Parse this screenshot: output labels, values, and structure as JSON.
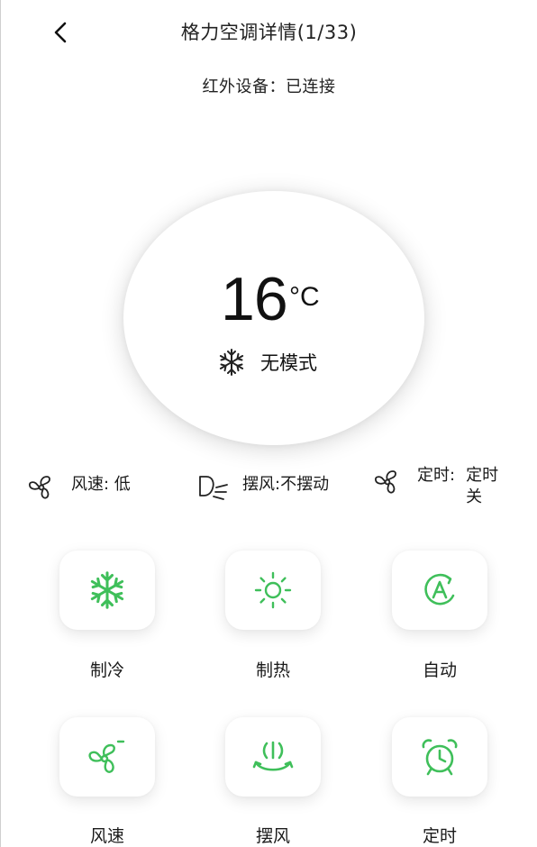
{
  "header": {
    "title": "格力空调详情(1/33)",
    "back_icon": "chevron-left-icon"
  },
  "status": {
    "label": "红外设备：",
    "value": "已连接"
  },
  "temperature": {
    "value": "16",
    "unit": "°C",
    "mode_icon": "snowflake-icon",
    "mode": "无模式"
  },
  "info": {
    "fan_speed": {
      "icon": "fan-icon",
      "text": "风速: 低"
    },
    "swing": {
      "icon": "swing-icon",
      "text": "摆风:不摆动"
    },
    "timer": {
      "icon": "fan-icon",
      "line1": "定时:",
      "line2": "定时关"
    }
  },
  "buttons": [
    {
      "label": "制冷",
      "icon": "snowflake-icon"
    },
    {
      "label": "制热",
      "icon": "sun-icon"
    },
    {
      "label": "自动",
      "icon": "auto-mode-icon"
    },
    {
      "label": "风速",
      "icon": "fan-speed-icon"
    },
    {
      "label": "摆风",
      "icon": "swing-wind-icon"
    },
    {
      "label": "定时",
      "icon": "alarm-clock-icon"
    }
  ],
  "colors": {
    "accent_green": "#3fbf5a",
    "text": "#1a1a1a"
  }
}
